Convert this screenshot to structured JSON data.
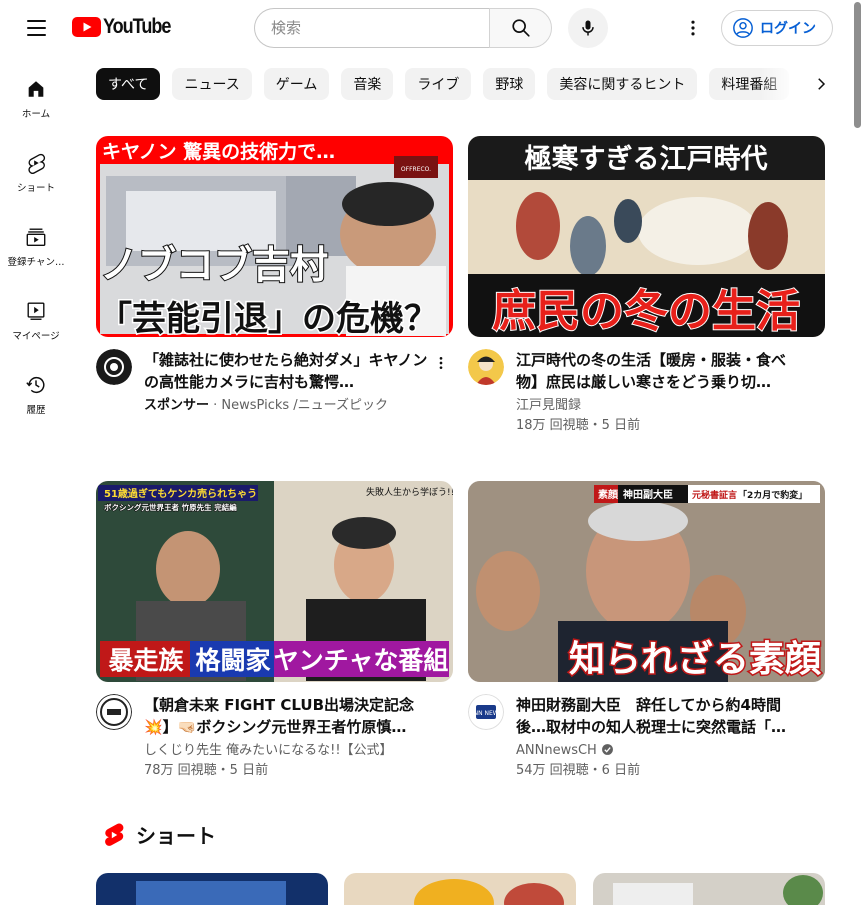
{
  "header": {
    "logo_text": "YouTube",
    "search_placeholder": "検索",
    "login_label": "ログイン"
  },
  "guide": [
    {
      "label": "ホーム",
      "icon": "home-icon"
    },
    {
      "label": "ショート",
      "icon": "shorts-icon"
    },
    {
      "label": "登録チャン…",
      "icon": "subscriptions-icon"
    },
    {
      "label": "マイページ",
      "icon": "library-icon"
    },
    {
      "label": "履歴",
      "icon": "history-icon"
    }
  ],
  "chips": [
    "すべて",
    "ニュース",
    "ゲーム",
    "音楽",
    "ライブ",
    "野球",
    "美容に関するヒント",
    "料理番組"
  ],
  "videos": [
    {
      "title": "「雑誌社に使わせたら絶対ダメ」キヤノンの高性能カメラに吉村も驚愕…",
      "sponsor_label": "スポンサー",
      "channel": " · NewsPicks /ニューズピック",
      "thumb_text": [
        "キヤノン 驚異の技術力で…",
        "ノブコブ吉村",
        "「芸能引退」の危機？"
      ],
      "thumb_badge": "OFFRECO."
    },
    {
      "title": "江戸時代の冬の生活【暖房・服装・食べ物】庶民は厳しい寒さをどう乗り切…",
      "channel": "江戸見聞録",
      "stats": "18万 回視聴・5 日前",
      "thumb_text": [
        "極寒すぎる江戸時代",
        "庶民の冬の生活"
      ]
    },
    {
      "title": "【朝倉未来 FIGHT CLUB出場決定記念💥】🤜🏻ボクシング元世界王者竹原慎…",
      "channel": "しくじり先生 俺みたいになるな!!【公式】",
      "stats": "78万 回視聴・5 日前",
      "thumb_text": [
        "51歳過ぎてもケンカ売られちゃう",
        "ボクシング元世界王者 竹原先生 完結編",
        "失敗人生から学ぼう!!",
        "暴走族",
        "格闘家",
        "ヤンチャな番組"
      ]
    },
    {
      "title": "神田財務副大臣　辞任してから約4時間後…取材中の知人税理士に突然電話「…",
      "channel": "ANNnewsCH",
      "stats": "54万 回視聴・6 日前",
      "thumb_text": [
        "素顔",
        "神田副大臣",
        "元秘書証言",
        "「2カ月で豹変」",
        "知られざる素顔"
      ],
      "avatar_text": "ANN NEWS"
    }
  ],
  "shorts": {
    "title": "ショート"
  },
  "colors": {
    "brand_red": "#ff0000",
    "link_blue": "#065fd4",
    "chip_bg": "#f2f2f2",
    "secondary_text": "#606060"
  }
}
